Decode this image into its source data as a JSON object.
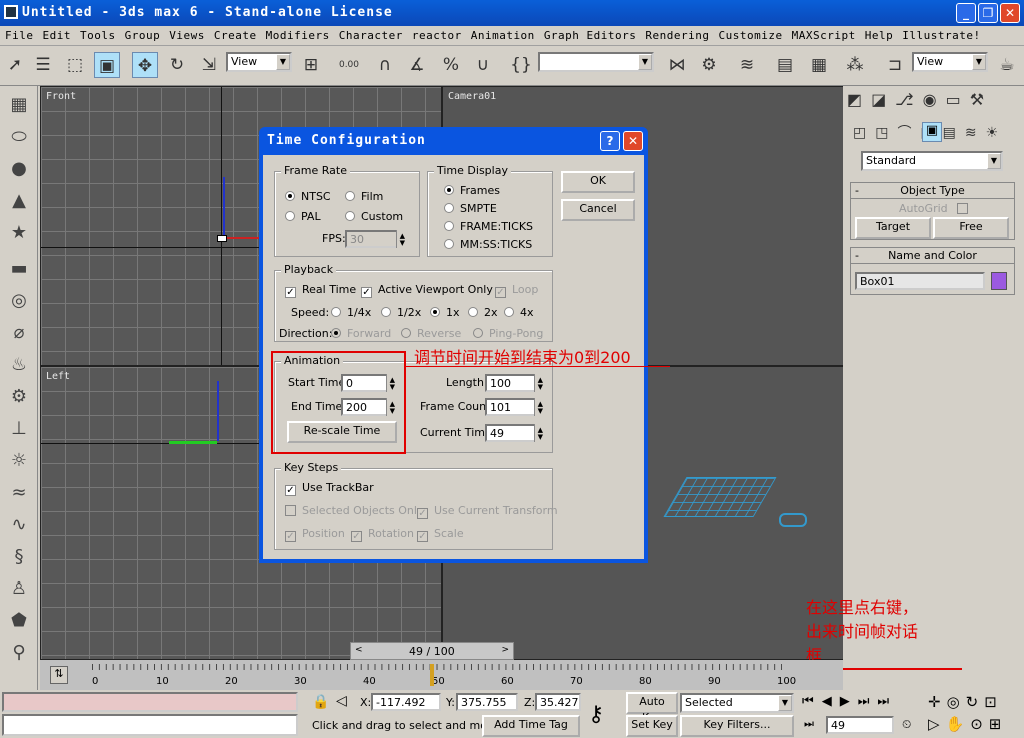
{
  "app": {
    "title": "Untitled - 3ds max 6 - Stand-alone License"
  },
  "menu": [
    "File",
    "Edit",
    "Tools",
    "Group",
    "Views",
    "Create",
    "Modifiers",
    "Character",
    "reactor",
    "Animation",
    "Graph Editors",
    "Rendering",
    "Customize",
    "MAXScript",
    "Help",
    "Illustrate!"
  ],
  "toolbar": {
    "view_combo": "View",
    "view_combo2": "View",
    "spinner_label": "0.00",
    "selection_set": ""
  },
  "viewports": {
    "front": "Front",
    "camera": "Camera01",
    "left": "Left"
  },
  "cmdpanel": {
    "category": "Standard",
    "object_type_title": "Object Type",
    "autogrid": "AutoGrid",
    "target": "Target",
    "free": "Free",
    "name_color_title": "Name and Color",
    "object_name": "Box01",
    "object_color": "#9b5ae0"
  },
  "dialog": {
    "title": "Time Configuration",
    "ok": "OK",
    "cancel": "Cancel",
    "frame_rate": {
      "title": "Frame Rate",
      "ntsc": "NTSC",
      "film": "Film",
      "pal": "PAL",
      "custom": "Custom",
      "fps_label": "FPS:",
      "fps_value": "30"
    },
    "time_display": {
      "title": "Time Display",
      "frames": "Frames",
      "smpte": "SMPTE",
      "frame_ticks": "FRAME:TICKS",
      "mm_ss_ticks": "MM:SS:TICKS"
    },
    "playback": {
      "title": "Playback",
      "real_time": "Real Time",
      "active_viewport_only": "Active Viewport Only",
      "loop": "Loop",
      "speed_label": "Speed:",
      "speeds": [
        "1/4x",
        "1/2x",
        "1x",
        "2x",
        "4x"
      ],
      "direction_label": "Direction:",
      "forward": "Forward",
      "reverse": "Reverse",
      "ping_pong": "Ping-Pong"
    },
    "animation": {
      "title": "Animation",
      "start_time_label": "Start Time:",
      "start_time": "0",
      "end_time_label": "End Time:",
      "end_time": "200",
      "rescale": "Re-scale Time",
      "length_label": "Length:",
      "length": "100",
      "frame_count_label": "Frame Count:",
      "frame_count": "101",
      "current_time_label": "Current Time:",
      "current_time": "49"
    },
    "key_steps": {
      "title": "Key Steps",
      "use_trackbar": "Use TrackBar",
      "selected_objects_only": "Selected Objects Only",
      "use_current_transform": "Use Current Transform",
      "position": "Position",
      "rotation": "Rotation",
      "scale": "Scale"
    }
  },
  "annotations": {
    "note1": "调节时间开始到结束为0到200",
    "note2_line1": "在这里点右键，",
    "note2_line2": "出来时间帧对话",
    "note2_line3": "框"
  },
  "timeline": {
    "slider": "49 / 100",
    "ticks": [
      "0",
      "10",
      "20",
      "30",
      "40",
      "50",
      "60",
      "70",
      "80",
      "90",
      "100"
    ],
    "current_frame": 0.49
  },
  "status": {
    "x_label": "X:",
    "x": "-117.492",
    "y_label": "Y:",
    "y": "375.755",
    "z_label": "Z:",
    "z": "35.427",
    "prompt": "Click and drag to select and move",
    "add_time_tag": "Add Time Tag",
    "auto_key": "Auto Key",
    "set_key": "Set Key",
    "selected": "Selected",
    "key_filters": "Key Filters...",
    "frame": "49"
  }
}
